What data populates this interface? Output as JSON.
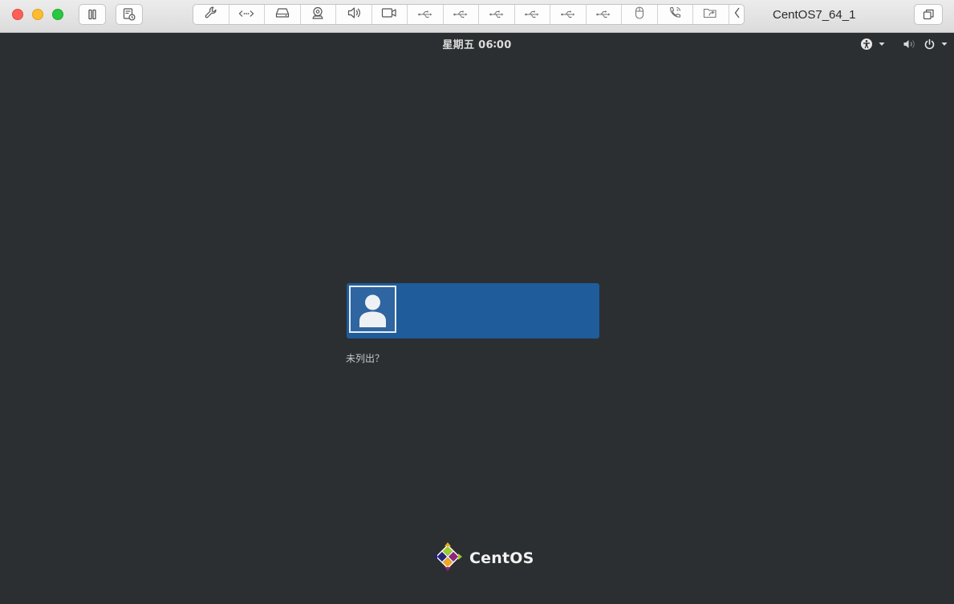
{
  "window": {
    "title": "CentOS7_64_1"
  },
  "toolbar": {
    "left_buttons": [
      {
        "icon": "pause-icon"
      },
      {
        "icon": "snapshot-icon"
      }
    ],
    "device_buttons": [
      {
        "icon": "wrench-icon"
      },
      {
        "icon": "network-arrows-icon"
      },
      {
        "icon": "hard-disk-icon"
      },
      {
        "icon": "camera-icon"
      },
      {
        "icon": "speaker-icon"
      },
      {
        "icon": "video-camera-icon"
      },
      {
        "icon": "usb-icon"
      },
      {
        "icon": "usb-icon"
      },
      {
        "icon": "usb-icon"
      },
      {
        "icon": "usb-icon"
      },
      {
        "icon": "usb-icon"
      },
      {
        "icon": "usb-icon"
      },
      {
        "icon": "mouse-icon"
      },
      {
        "icon": "phone-icon"
      },
      {
        "icon": "shared-folder-icon"
      },
      {
        "icon": "chevron-left-icon"
      }
    ],
    "right_button": {
      "icon": "windows-stack-icon"
    }
  },
  "login": {
    "clock": "星期五 06∶00",
    "not_listed": "未列出？",
    "brand": "CentOS",
    "tray": [
      "accessibility-icon",
      "volume-icon",
      "power-icon"
    ]
  },
  "colors": {
    "background": "#2b2f31",
    "user_card": "#1e5c9c",
    "close": "#fe5f57",
    "minimize": "#febc2e",
    "zoom": "#28c840"
  }
}
